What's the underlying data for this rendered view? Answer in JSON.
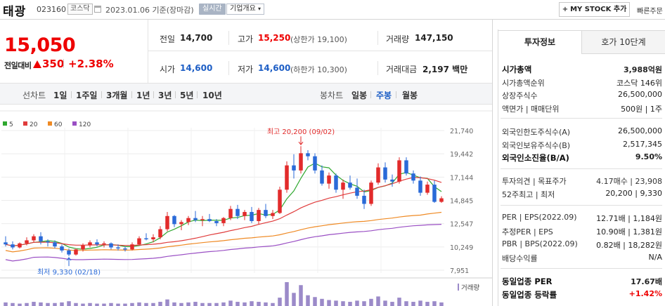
{
  "header": {
    "stock_name": "태광",
    "stock_code": "023160",
    "market": "코스닥",
    "date": "2023.01.06",
    "date_suffix": "기준(장마감)",
    "realtime": "실시간",
    "overview": "기업개요",
    "mystock": "MY STOCK 추가",
    "quick": "빠른주문"
  },
  "price": {
    "current": "15,050",
    "change_label": "전일대비",
    "change": "350",
    "rate": "+2.38%"
  },
  "quote": {
    "prev_label": "전일",
    "prev": "14,700",
    "high_label": "고가",
    "high": "15,250",
    "upper_label": "(상한가",
    "upper": "19,100)",
    "volume_label": "거래량",
    "volume": "147,150",
    "open_label": "시가",
    "open": "14,600",
    "low_label": "저가",
    "low": "14,600",
    "lower_label": "(하한가",
    "lower": "10,300)",
    "amount_label": "거래대금",
    "amount": "2,197",
    "amount_unit": "백만"
  },
  "chart_tabs": {
    "line_label": "선차트",
    "periods": [
      "1일",
      "1주일",
      "3개월",
      "1년",
      "3년",
      "5년",
      "10년"
    ],
    "candle_label": "봉차트",
    "candles": [
      "일봉",
      "주봉",
      "월봉"
    ],
    "active_candle": "주봉"
  },
  "chart_data": {
    "type": "candlestick",
    "legend": [
      {
        "name": "5",
        "color": "#2fa82f"
      },
      {
        "name": "20",
        "color": "#e03c3c"
      },
      {
        "name": "60",
        "color": "#ef8a24"
      },
      {
        "name": "120",
        "color": "#9a4fc4"
      }
    ],
    "y_ticks": [
      "21,740",
      "19,442",
      "17,144",
      "14,845",
      "12,547",
      "10,249",
      "7,951"
    ],
    "ylim": [
      7951,
      21740
    ],
    "high_annotation": "최고 20,200 (09/02)",
    "low_annotation": "최저 9,330 (02/18)",
    "volume_label": "거래량",
    "candles": [
      [
        10700,
        11300,
        10300,
        10500
      ],
      [
        10500,
        10800,
        10000,
        10200
      ],
      [
        10200,
        10700,
        10100,
        10600
      ],
      [
        10600,
        11200,
        10400,
        10900
      ],
      [
        10900,
        11500,
        10700,
        11300
      ],
      [
        11300,
        11700,
        10500,
        10800
      ],
      [
        10800,
        11000,
        10300,
        10700
      ],
      [
        10700,
        10900,
        10100,
        10300
      ],
      [
        10300,
        10500,
        9700,
        9900
      ],
      [
        9900,
        10100,
        9330,
        9500
      ],
      [
        9500,
        10100,
        9400,
        10000
      ],
      [
        10000,
        10600,
        9800,
        10400
      ],
      [
        10400,
        10900,
        10200,
        10700
      ],
      [
        10700,
        11000,
        10300,
        10500
      ],
      [
        10500,
        10800,
        10200,
        10600
      ],
      [
        10600,
        10700,
        10000,
        10200
      ],
      [
        10200,
        10500,
        9900,
        10100
      ],
      [
        10100,
        10300,
        9800,
        10000
      ],
      [
        10000,
        10700,
        9900,
        10500
      ],
      [
        10500,
        11300,
        10400,
        11100
      ],
      [
        11100,
        11600,
        10900,
        11000
      ],
      [
        11000,
        11500,
        10700,
        11200
      ],
      [
        11200,
        12300,
        11000,
        12000
      ],
      [
        12000,
        13700,
        11800,
        13300
      ],
      [
        13300,
        13400,
        12200,
        12500
      ],
      [
        12500,
        12900,
        11900,
        12700
      ],
      [
        12700,
        13300,
        12400,
        13100
      ],
      [
        13100,
        13800,
        12700,
        12900
      ],
      [
        12900,
        13300,
        12300,
        13000
      ],
      [
        13000,
        13500,
        12700,
        12800
      ],
      [
        12800,
        13000,
        12300,
        12600
      ],
      [
        12600,
        13200,
        12300,
        13100
      ],
      [
        13100,
        14300,
        12900,
        14000
      ],
      [
        14000,
        14400,
        13000,
        13300
      ],
      [
        13300,
        13900,
        12900,
        13700
      ],
      [
        13700,
        14200,
        12600,
        12800
      ],
      [
        12800,
        14100,
        12500,
        13900
      ],
      [
        13900,
        14500,
        13100,
        13300
      ],
      [
        13300,
        13900,
        13000,
        13600
      ],
      [
        13600,
        16200,
        13500,
        15900
      ],
      [
        15900,
        18700,
        15600,
        18300
      ],
      [
        18300,
        19400,
        17000,
        17800
      ],
      [
        17800,
        20200,
        17500,
        19500
      ],
      [
        19500,
        19800,
        18800,
        19200
      ],
      [
        19200,
        19500,
        17500,
        17800
      ],
      [
        17800,
        18300,
        16300,
        16500
      ],
      [
        16500,
        17600,
        16000,
        17300
      ],
      [
        17300,
        17500,
        15600,
        15900
      ],
      [
        15900,
        16900,
        15000,
        16600
      ],
      [
        16600,
        17300,
        15900,
        16100
      ],
      [
        16100,
        17000,
        15000,
        15300
      ],
      [
        15300,
        15900,
        14000,
        14500
      ],
      [
        14500,
        16800,
        14300,
        16600
      ],
      [
        16600,
        18500,
        16400,
        18100
      ],
      [
        18100,
        18600,
        16600,
        16900
      ],
      [
        16900,
        17400,
        16200,
        16700
      ],
      [
        16700,
        19100,
        16500,
        18800
      ],
      [
        18800,
        19100,
        17300,
        17500
      ],
      [
        17500,
        17800,
        16500,
        16800
      ],
      [
        16800,
        17200,
        15300,
        15600
      ],
      [
        15600,
        16700,
        15400,
        16400
      ],
      [
        16400,
        16800,
        14600,
        14700
      ],
      [
        14700,
        15250,
        14600,
        15050
      ]
    ],
    "volumes": [
      6,
      5,
      4,
      5,
      7,
      6,
      5,
      5,
      6,
      8,
      5,
      4,
      5,
      4,
      4,
      5,
      4,
      4,
      5,
      6,
      5,
      5,
      7,
      11,
      6,
      5,
      6,
      7,
      5,
      5,
      5,
      6,
      9,
      7,
      6,
      8,
      7,
      6,
      5,
      14,
      40,
      22,
      35,
      18,
      15,
      12,
      10,
      9,
      8,
      7,
      9,
      8,
      12,
      16,
      9,
      7,
      14,
      8,
      7,
      9,
      7,
      8,
      6
    ]
  },
  "right_panel": {
    "tab1": "투자정보",
    "tab2": "호가 10단계",
    "rows": [
      {
        "k": "시가총액",
        "v": "3,988억원",
        "bold": true
      },
      {
        "k": "시가총액순위",
        "v": "코스닥 146위"
      },
      {
        "k": "상장주식수",
        "v": "26,500,000"
      },
      {
        "k": "액면가 | 매매단위",
        "v": "500원 | 1주"
      },
      {
        "k": "외국인한도주식수(A)",
        "v": "26,500,000"
      },
      {
        "k": "외국인보유주식수(B)",
        "v": "2,517,345"
      },
      {
        "k": "외국인소진율(B/A)",
        "v": "9.50%",
        "bold": true
      },
      {
        "k": "투자의견 | 목표주가",
        "v": "4.17매수 | 23,908"
      },
      {
        "k": "52주최고 | 최저",
        "v": "20,200 | 9,330"
      },
      {
        "k": "PER | EPS(2022.09)",
        "v": "12.71배 | 1,184원"
      },
      {
        "k": "추정PER | EPS",
        "v": "10.90배 | 1,381원"
      },
      {
        "k": "PBR | BPS(2022.09)",
        "v": "0.82배 | 18,282원"
      },
      {
        "k": "배당수익률",
        "v": "N/A"
      },
      {
        "k": "동일업종 PER",
        "v": "17.67배",
        "bold": true
      },
      {
        "k": "동일업종 등락률",
        "v": "+1.42%",
        "bold": true
      }
    ]
  }
}
